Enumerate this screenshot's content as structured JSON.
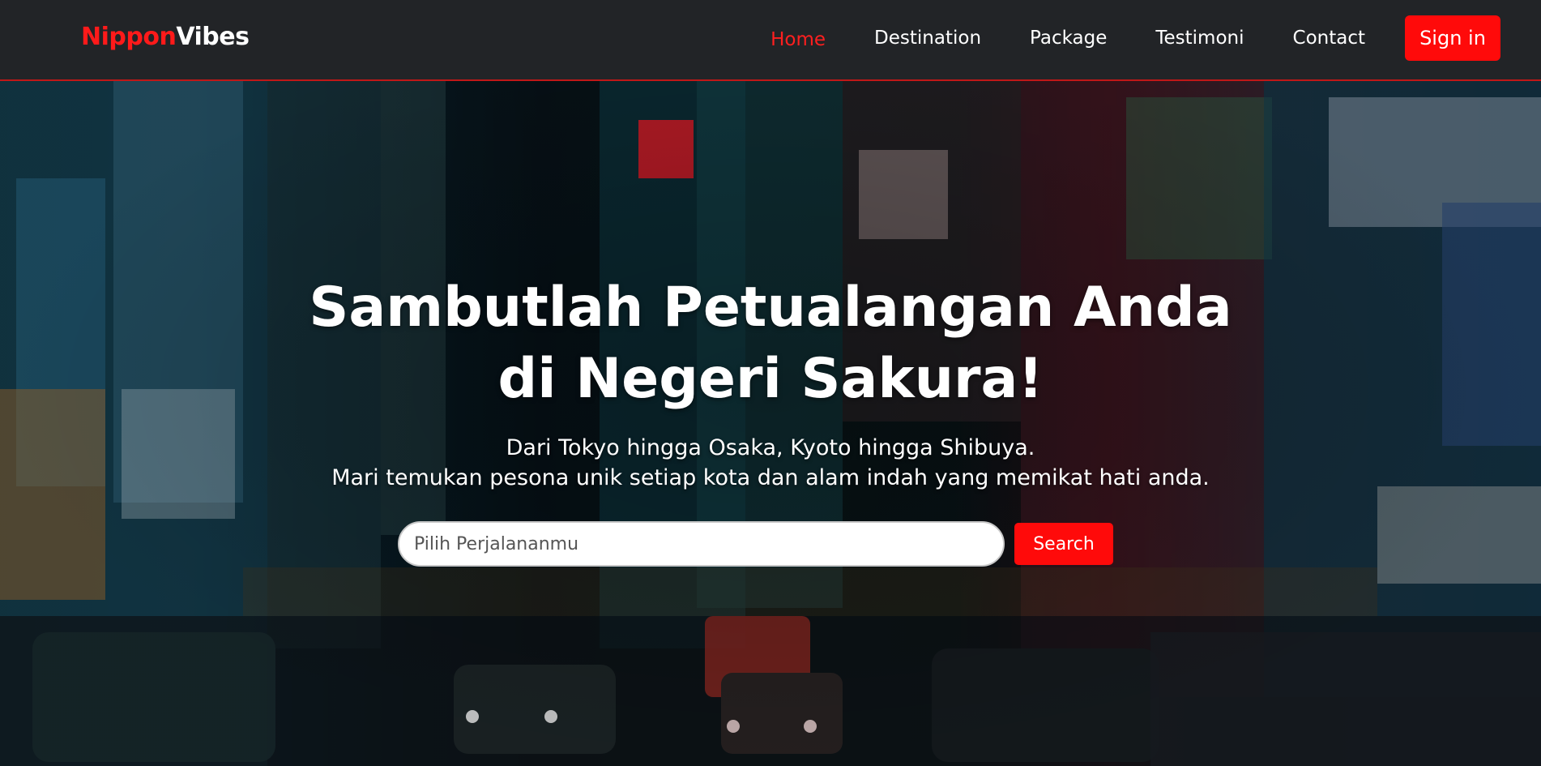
{
  "brand": {
    "part1": "Nippon",
    "part2": "Vibes"
  },
  "nav": {
    "items": [
      {
        "label": "Home",
        "active": true
      },
      {
        "label": "Destination",
        "active": false
      },
      {
        "label": "Package",
        "active": false
      },
      {
        "label": "Testimoni",
        "active": false
      },
      {
        "label": "Contact",
        "active": false
      }
    ],
    "signin_label": "Sign in"
  },
  "hero": {
    "title_line1": "Sambutlah Petualangan Anda",
    "title_line2": "di Negeri Sakura!",
    "subtitle_line1": "Dari Tokyo hingga Osaka, Kyoto hingga Shibuya.",
    "subtitle_line2": "Mari temukan pesona unik setiap kota dan alam indah yang memikat hati anda."
  },
  "search": {
    "placeholder": "Pilih Perjalananmu",
    "value": "",
    "button_label": "Search"
  },
  "colors": {
    "accent": "#ff0a0a",
    "nav_bg": "#222427",
    "text": "#ffffff"
  }
}
